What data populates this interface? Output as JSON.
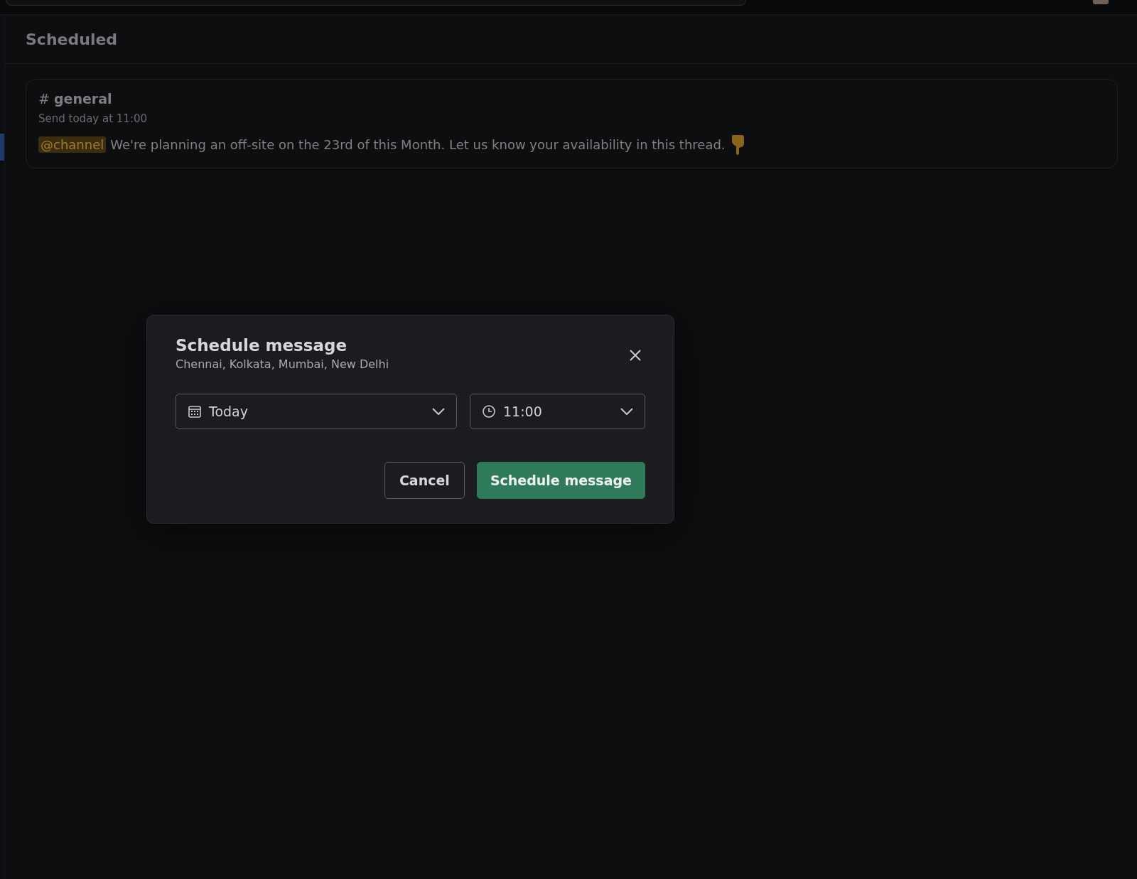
{
  "header": {
    "title": "Scheduled"
  },
  "scheduled_message": {
    "channel": "general",
    "channel_prefix": "#",
    "send_time": "Send today at 11:00",
    "mention": "@channel",
    "text": "We're planning an off-site on the 23rd of this Month. Let us know your availability in this thread."
  },
  "dialog": {
    "title": "Schedule message",
    "timezone": "Chennai, Kolkata, Mumbai, New Delhi",
    "date": "Today",
    "time": "11:00",
    "buttons": [
      {
        "label": "Cancel",
        "kind": "secondary"
      },
      {
        "label": "Schedule message",
        "kind": "primary"
      }
    ]
  }
}
